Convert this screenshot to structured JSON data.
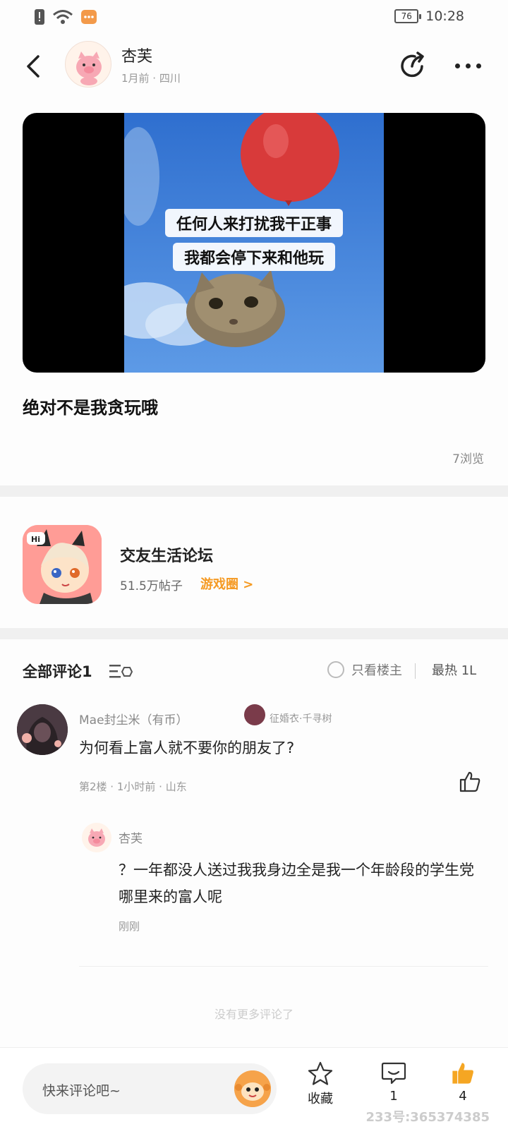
{
  "status_bar": {
    "time": "10:28",
    "battery": "76"
  },
  "header": {
    "author_name": "杏芙",
    "author_meta": "1月前 · 四川"
  },
  "video": {
    "caption_line1": "任何人来打扰我干正事",
    "caption_line2": "我都会停下来和他玩"
  },
  "post": {
    "title": "绝对不是我贪玩哦",
    "views": "7浏览"
  },
  "forum": {
    "name": "交友生活论坛",
    "posts": "51.5万帖子",
    "link_label": "游戏圈 >"
  },
  "comments_section": {
    "all_label": "全部评论1",
    "author_only_label": "只看楼主",
    "sort_label": "最热 1L",
    "no_more": "没有更多评论了"
  },
  "comment": {
    "name": "Mae封尘米（有币）",
    "badge": "征婚衣·千寻树",
    "text": "为何看上富人就不要你的朋友了?",
    "meta": "第2楼 · 1小时前 · 山东"
  },
  "reply": {
    "name": "杏芙",
    "text": "？一年都没人送过我我身边全是我一个年龄段的学生党哪里来的富人呢",
    "time": "刚刚"
  },
  "bottom_bar": {
    "placeholder": "快来评论吧~",
    "favorite_label": "收藏",
    "comment_count": "1",
    "like_count": "4",
    "watermark": "233号:365374385"
  },
  "colors": {
    "accent": "#f59a23",
    "like": "#f5a623"
  }
}
